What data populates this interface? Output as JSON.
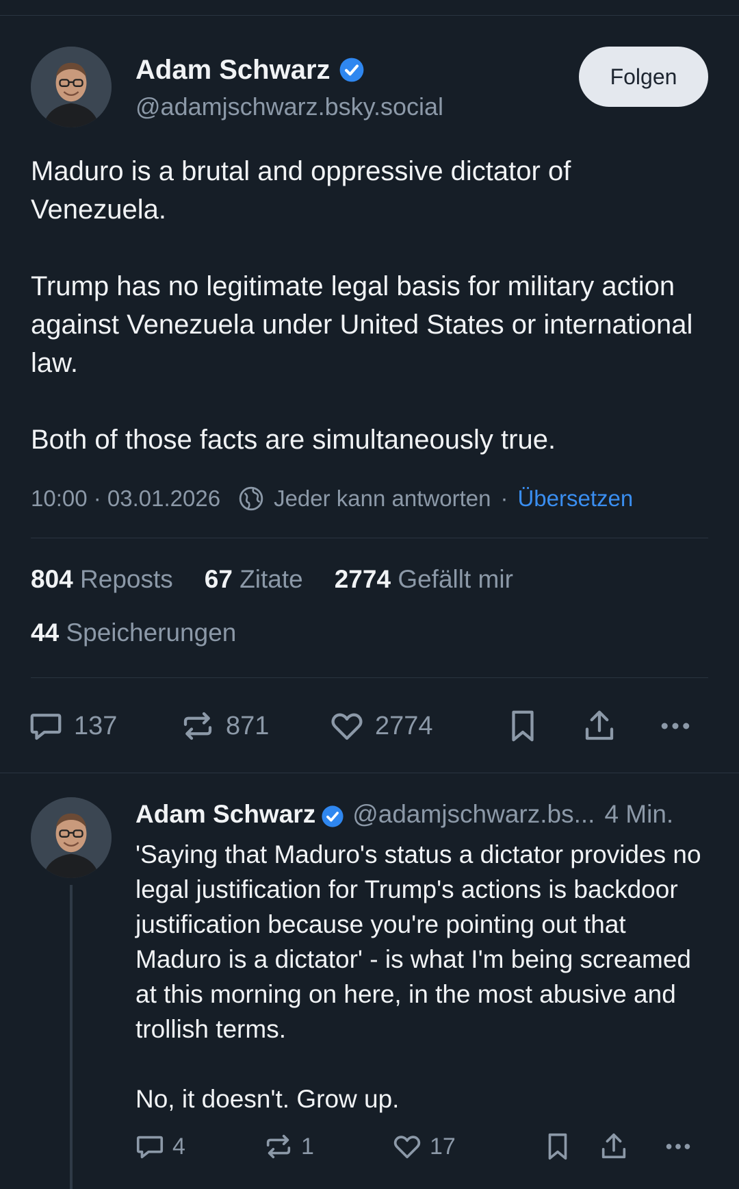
{
  "post": {
    "author_name": "Adam Schwarz",
    "author_handle": "@adamjschwarz.bsky.social",
    "follow_label": "Folgen",
    "paragraphs": [
      "Maduro is a brutal and oppressive dictator of Venezuela.",
      "Trump has no legitimate legal basis for military action against Venezuela under United States or international law.",
      "Both of those facts are simultaneously true."
    ],
    "timestamp": "10:00 · 03.01.2026",
    "reply_setting": "Jeder kann antworten",
    "meta_separator": "·",
    "translate_label": "Übersetzen",
    "stats": {
      "reposts_count": "804",
      "reposts_label": "Reposts",
      "quotes_count": "67",
      "quotes_label": "Zitate",
      "likes_count": "2774",
      "likes_label": "Gefällt mir",
      "saves_count": "44",
      "saves_label": "Speicherungen"
    },
    "actions": {
      "replies": "137",
      "reposts": "871",
      "likes": "2774"
    }
  },
  "reply": {
    "author_name": "Adam Schwarz",
    "author_handle": "@adamjschwarz.bs...",
    "time": "4 Min.",
    "paragraphs": [
      "'Saying that Maduro's status a dictator provides no legal justification for Trump's actions is backdoor justification because you're pointing out that Maduro is a dictator' - is what I'm being screamed at this morning on here, in the most abusive and trollish terms.",
      "No, it doesn't. Grow up."
    ],
    "actions": {
      "replies": "4",
      "reposts": "1",
      "likes": "17"
    }
  },
  "icons": {
    "verified": "verified-badge-icon",
    "globe": "globe-icon",
    "reply": "speech-bubble-icon",
    "repost": "repost-arrows-icon",
    "like": "heart-icon",
    "bookmark": "bookmark-icon",
    "share": "share-icon",
    "more": "more-dots-icon"
  },
  "colors": {
    "background": "#161e27",
    "text": "#f1f3f5",
    "muted": "#8c99a8",
    "accent": "#3a8ef0",
    "verified": "#2f87f0"
  }
}
